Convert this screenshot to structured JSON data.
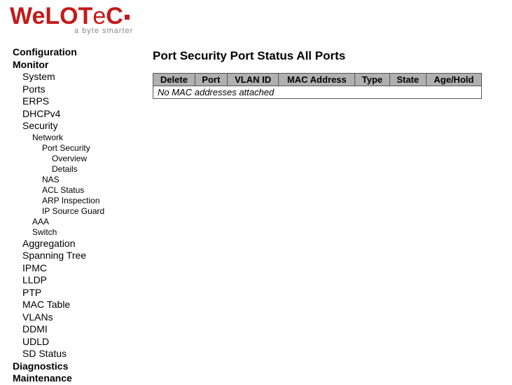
{
  "logo": {
    "text": "WELOTEC",
    "tagline": "a byte smarter"
  },
  "nav": {
    "configuration": "Configuration",
    "monitor": "Monitor",
    "system": "System",
    "ports": "Ports",
    "erps": "ERPS",
    "dhcpv4": "DHCPv4",
    "security": "Security",
    "network": "Network",
    "port_security": "Port Security",
    "overview": "Overview",
    "details": "Details",
    "nas": "NAS",
    "acl_status": "ACL Status",
    "arp_inspection": "ARP Inspection",
    "ip_source_guard": "IP Source Guard",
    "aaa": "AAA",
    "switch": "Switch",
    "aggregation": "Aggregation",
    "spanning_tree": "Spanning Tree",
    "ipmc": "IPMC",
    "lldp": "LLDP",
    "ptp": "PTP",
    "mac_table": "MAC Table",
    "vlans": "VLANs",
    "ddmi": "DDMI",
    "udld": "UDLD",
    "sd_status": "SD Status",
    "diagnostics": "Diagnostics",
    "maintenance": "Maintenance"
  },
  "page": {
    "title": "Port Security Port Status  All Ports",
    "columns": {
      "delete": "Delete",
      "port": "Port",
      "vlan_id": "VLAN ID",
      "mac": "MAC Address",
      "type": "Type",
      "state": "State",
      "age": "Age/Hold"
    },
    "empty_msg": "No MAC addresses attached"
  }
}
